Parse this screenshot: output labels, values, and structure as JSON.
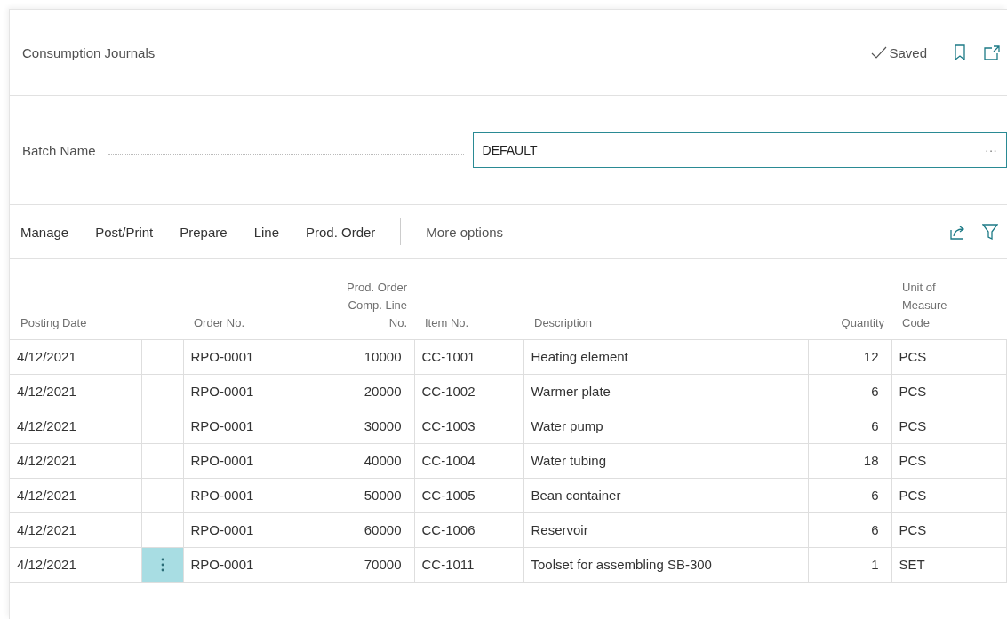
{
  "page": {
    "title": "Consumption Journals",
    "save_status": "Saved"
  },
  "batch": {
    "label": "Batch Name",
    "value": "DEFAULT",
    "more": "···"
  },
  "actions": [
    {
      "label": "Manage",
      "kind": "primary"
    },
    {
      "label": "Post/Print",
      "kind": "primary"
    },
    {
      "label": "Prepare",
      "kind": "primary"
    },
    {
      "label": "Line",
      "kind": "primary"
    },
    {
      "label": "Prod. Order",
      "kind": "primary"
    },
    {
      "label": "More options",
      "kind": "more"
    }
  ],
  "table": {
    "columns": [
      "Posting Date",
      "Order No.",
      "Prod. Order Comp. Line No.",
      "Item No.",
      "Description",
      "Quantity",
      "Unit of Measure Code"
    ],
    "rows": [
      {
        "selected": false,
        "cells": [
          "4/12/2021",
          "RPO-0001",
          "10000",
          "CC-1001",
          "Heating element",
          "12",
          "PCS"
        ]
      },
      {
        "selected": false,
        "cells": [
          "4/12/2021",
          "RPO-0001",
          "20000",
          "CC-1002",
          "Warmer plate",
          "6",
          "PCS"
        ]
      },
      {
        "selected": false,
        "cells": [
          "4/12/2021",
          "RPO-0001",
          "30000",
          "CC-1003",
          "Water pump",
          "6",
          "PCS"
        ]
      },
      {
        "selected": false,
        "cells": [
          "4/12/2021",
          "RPO-0001",
          "40000",
          "CC-1004",
          "Water tubing",
          "18",
          "PCS"
        ]
      },
      {
        "selected": false,
        "cells": [
          "4/12/2021",
          "RPO-0001",
          "50000",
          "CC-1005",
          "Bean container",
          "6",
          "PCS"
        ]
      },
      {
        "selected": false,
        "cells": [
          "4/12/2021",
          "RPO-0001",
          "60000",
          "CC-1006",
          "Reservoir",
          "6",
          "PCS"
        ]
      },
      {
        "selected": true,
        "cells": [
          "4/12/2021",
          "RPO-0001",
          "70000",
          "CC-1011",
          "Toolset for assembling SB-300",
          "1",
          "SET"
        ]
      }
    ]
  }
}
